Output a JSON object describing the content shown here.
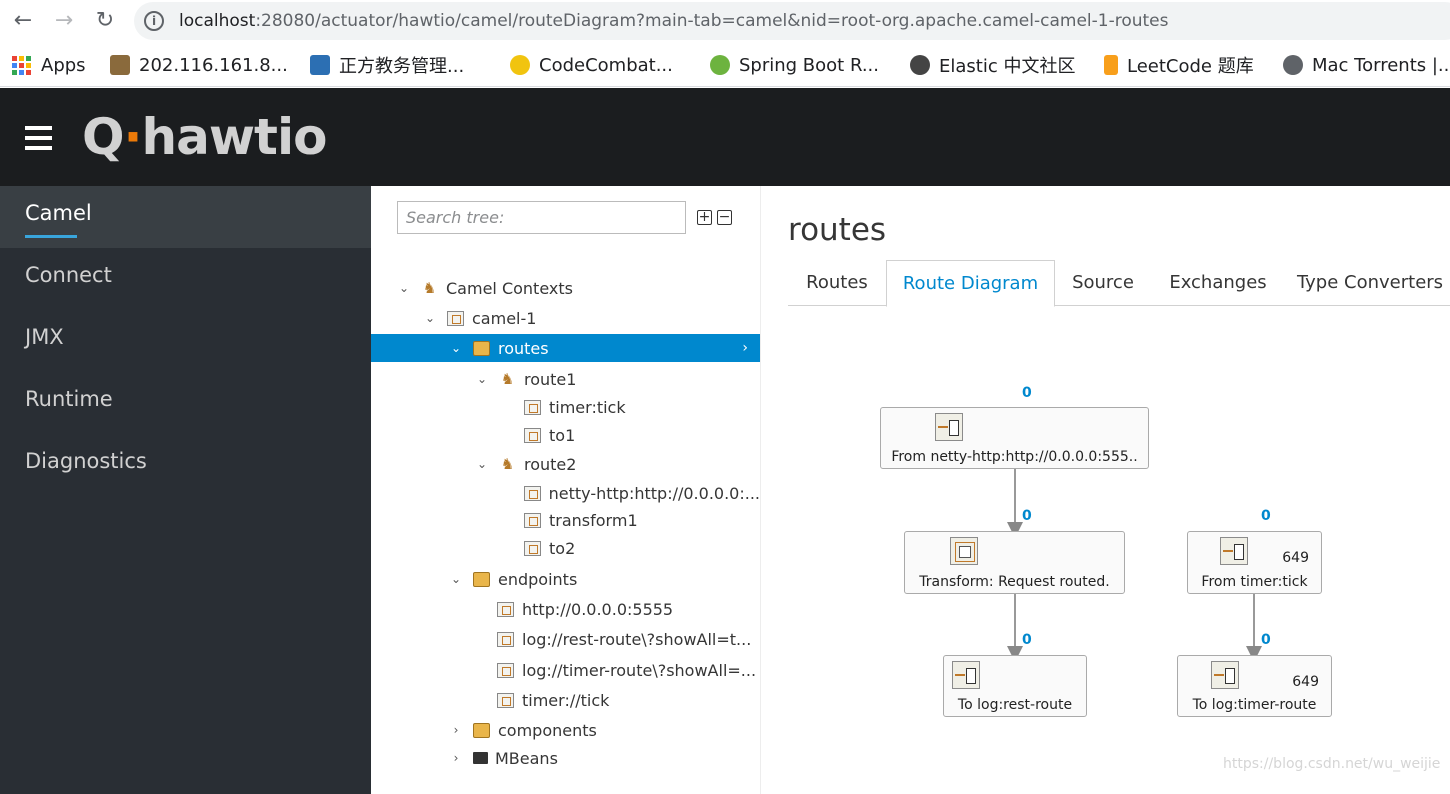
{
  "browser": {
    "url_host": "localhost",
    "url_rest": ":28080/actuator/hawtio/camel/routeDiagram?main-tab=camel&nid=root-org.apache.camel-camel-1-routes",
    "back": "←",
    "forward": "→",
    "reload": "↻",
    "info": "i"
  },
  "bookmarks": [
    {
      "label": "Apps"
    },
    {
      "label": "202.116.161.8..."
    },
    {
      "label": "正方教务管理..."
    },
    {
      "label": "CodeCombat..."
    },
    {
      "label": "Spring Boot R..."
    },
    {
      "label": "Elastic 中文社区"
    },
    {
      "label": "LeetCode 题库"
    },
    {
      "label": "Mac Torrents |..."
    }
  ],
  "nav": {
    "items": [
      "Camel",
      "Connect",
      "JMX",
      "Runtime",
      "Diagnostics"
    ]
  },
  "tree": {
    "search_placeholder": "Search tree:",
    "expand": "+",
    "collapse": "−",
    "rows": [
      {
        "label": "Camel Contexts"
      },
      {
        "label": "camel-1"
      },
      {
        "label": "routes"
      },
      {
        "label": "route1"
      },
      {
        "label": "timer:tick"
      },
      {
        "label": "to1"
      },
      {
        "label": "route2"
      },
      {
        "label": "netty-http:http://0.0.0.0:..."
      },
      {
        "label": "transform1"
      },
      {
        "label": "to2"
      },
      {
        "label": "endpoints"
      },
      {
        "label": "http://0.0.0.0:5555"
      },
      {
        "label": "log://rest-route\\?showAll=t..."
      },
      {
        "label": "log://timer-route\\?showAll=..."
      },
      {
        "label": "timer://tick"
      },
      {
        "label": "components"
      },
      {
        "label": "MBeans"
      }
    ]
  },
  "main": {
    "title": "routes",
    "tabs": [
      "Routes",
      "Route Diagram",
      "Source",
      "Exchanges",
      "Type Converters"
    ],
    "active_tab": "Route Diagram",
    "nodes": [
      {
        "label": "From netty-http:http://0.0.0.0:555..",
        "counter": "0",
        "count": ""
      },
      {
        "label": "Transform: Request routed.",
        "counter": "0",
        "count": ""
      },
      {
        "label": "To log:rest-route",
        "counter": "0",
        "count": ""
      },
      {
        "label": "From timer:tick",
        "counter": "0",
        "count": "649"
      },
      {
        "label": "To log:timer-route",
        "counter": "0",
        "count": "649"
      }
    ],
    "watermark": "https://blog.csdn.net/wu_weijie"
  }
}
